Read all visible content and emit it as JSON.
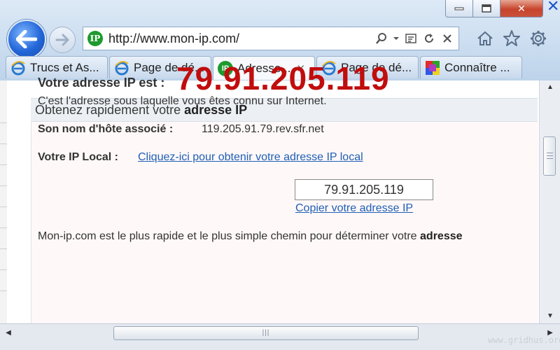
{
  "browser": {
    "url": "http://www.mon-ip.com/",
    "tabs": [
      {
        "label": "Trucs et As...",
        "icon": "ie-icon",
        "active": false
      },
      {
        "label": "Page de dé...",
        "icon": "ie-icon",
        "active": false
      },
      {
        "label": "Adresse...",
        "icon": "ip-site-icon",
        "active": true
      },
      {
        "label": "Page de dé...",
        "icon": "ie-icon",
        "active": false
      },
      {
        "label": "Connaître ...",
        "icon": "colorful-squares-icon",
        "active": false
      }
    ],
    "site_icon_text": "IP",
    "close_window_symbol": "✕"
  },
  "page": {
    "header_prefix": "Obtenez rapidement votre ",
    "header_bold": "adresse IP",
    "ip_label": "Votre adresse IP est :",
    "ip_value": "79.91.205.119",
    "ip_description": "C'est l'adresse sous laquelle vous êtes connu sur Internet.",
    "hostname_label": "Son nom d'hôte associé :",
    "hostname_value": "119.205.91.79.rev.sfr.net",
    "local_ip_label": "Votre IP Local :",
    "local_ip_link": "Cliquez-ici pour obtenir votre adresse IP local",
    "ip_box_value": "79.91.205.119",
    "copy_link": "Copier votre adresse IP",
    "bottom_text": "Mon-ip.com est le plus rapide et le plus simple chemin pour déterminer votre ",
    "bottom_text_bold": "adresse"
  },
  "watermark": "www.gridhus.org",
  "colors": {
    "ip_red": "#c10d0d",
    "link_blue": "#1f5fb5",
    "close_red": "#c7442c"
  }
}
